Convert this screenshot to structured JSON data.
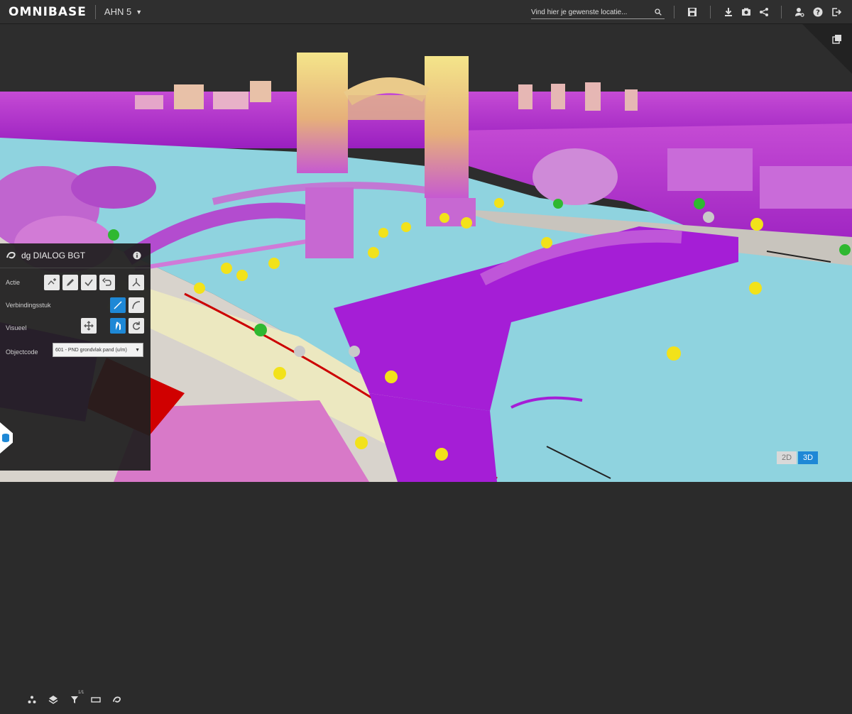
{
  "app": {
    "logo": "OMNIBASE",
    "dataset": "AHN 5"
  },
  "search": {
    "placeholder": "Vind hier je gewenste locatie..."
  },
  "icons": {
    "search": "search-icon",
    "save": "save-icon",
    "download": "download-icon",
    "screenshot": "camera-icon",
    "share": "share-icon",
    "user_settings": "user-settings-icon",
    "help": "help-icon",
    "logout": "logout-icon",
    "fullscreen": "fullscreen-icon"
  },
  "dialog": {
    "title": "dg DIALOG BGT",
    "rows": {
      "actie": "Actie",
      "verbindingsstuk": "Verbindingsstuk",
      "visueel": "Visueel",
      "objectcode": "Objectcode"
    },
    "objectcode_value": "601 - PND grondvlak pand (u/m)"
  },
  "bottom_bar": {
    "filter_badge": "1/1",
    "icons": [
      "share-nodes-icon",
      "layers-icon",
      "filter-icon",
      "ruler-icon",
      "dg-logo-icon"
    ]
  },
  "view_mode": {
    "two_d": "2D",
    "three_d": "3D",
    "active": "3D"
  },
  "colors": {
    "accent": "#1e88d6",
    "topbar": "#2f2f2f",
    "panel": "#1e1e1e",
    "water": "#8fd3df",
    "points": "#a020c8"
  }
}
